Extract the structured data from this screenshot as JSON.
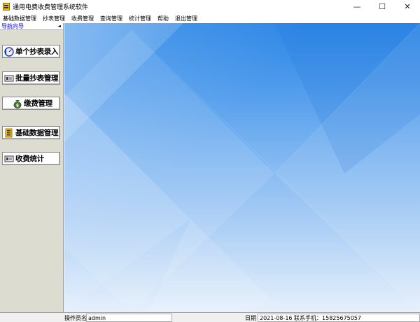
{
  "window": {
    "title": "通用电费收费管理系统软件",
    "minimize_glyph": "—",
    "maximize_glyph": "☐",
    "close_glyph": "✕"
  },
  "menu": [
    {
      "label": "基础数据管理"
    },
    {
      "label": "抄表管理"
    },
    {
      "label": "收费管理"
    },
    {
      "label": "查询管理"
    },
    {
      "label": "统计管理"
    },
    {
      "label": "帮助"
    },
    {
      "label": "退出管理"
    }
  ],
  "nav": {
    "title": "导航向导",
    "collapse_glyph": "◄",
    "buttons": [
      {
        "label": "单个抄表录入",
        "icon": "meter-gauge-icon"
      },
      {
        "label": "批量抄表管理",
        "icon": "device-card-icon"
      },
      {
        "label": "缴费管理",
        "icon": "money-bag-icon"
      },
      {
        "label": "基础数据管理",
        "icon": "data-sheet-icon"
      },
      {
        "label": "收费统计",
        "icon": "device-card-icon"
      }
    ]
  },
  "status": {
    "operator_label": "操作员名",
    "operator_value": "admin",
    "date_label": "日期",
    "date_value": "2021-08-16 联系手机：15825675057"
  }
}
